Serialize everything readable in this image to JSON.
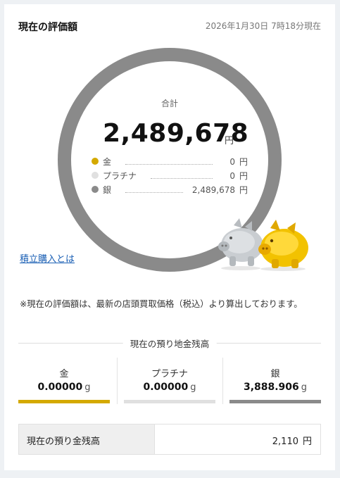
{
  "header": {
    "title": "現在の評価額",
    "date": "2026年1月30日 7時18分現在"
  },
  "summary": {
    "total_label": "合計",
    "total_amount": "2,489,678",
    "total_unit": "円",
    "breakdown": [
      {
        "name": "金",
        "value": "0",
        "unit": "円",
        "color": "#d4a900"
      },
      {
        "name": "プラチナ",
        "value": "0",
        "unit": "円",
        "color": "#e0e0e0"
      },
      {
        "name": "銀",
        "value": "2,489,678",
        "unit": "円",
        "color": "#8a8a8a"
      }
    ]
  },
  "links": {
    "tsumitate": "積立購入とは"
  },
  "note": "※現在の評価額は、最新の店頭買取価格（税込）より算出しております。",
  "holdings": {
    "title": "現在の預り地金残高",
    "metals": [
      {
        "name": "金",
        "amount": "0.00000",
        "unit": "g",
        "color": "#d4a900"
      },
      {
        "name": "プラチナ",
        "amount": "0.00000",
        "unit": "g",
        "color": "#e0e0e0"
      },
      {
        "name": "銀",
        "amount": "3,888.906",
        "unit": "g",
        "color": "#8a8a8a"
      }
    ]
  },
  "cash": {
    "label": "現在の預り金残高",
    "value": "2,110",
    "unit": "円"
  }
}
